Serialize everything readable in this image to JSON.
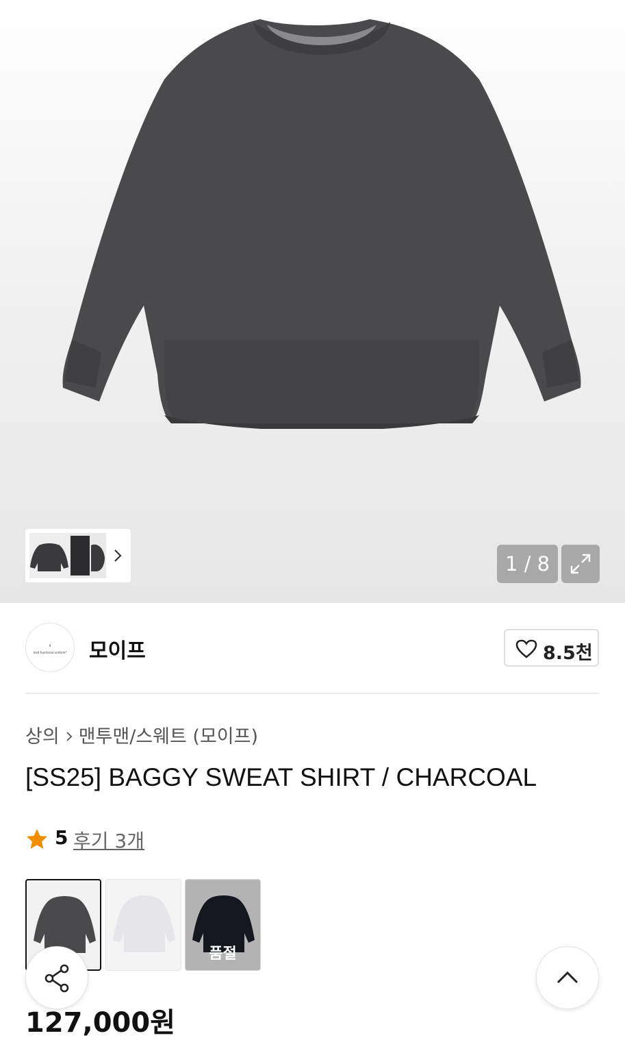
{
  "gallery": {
    "counter": "1 / 8",
    "thumbnail_next_icon": "chevron-right-icon",
    "expand_icon": "expand-icon",
    "colors": {
      "sweatshirt": "#4a4a4c",
      "overlay": "#a8a8a8"
    }
  },
  "brand": {
    "name": "모이프",
    "logo_text": "⌽",
    "logo_subtext": "moif functional uniform*",
    "like_count": "8.5천",
    "like_icon": "heart-icon"
  },
  "breadcrumb": {
    "category": "상의",
    "subcategory": "맨투맨/스웨트 (모이프)",
    "separator_icon": "chevron-right-icon"
  },
  "product": {
    "title": "[SS25] BAGGY SWEAT SHIRT / CHARCOAL",
    "rating": "5",
    "reviews_label": "후기 3개",
    "rating_color": "#f28c00",
    "price": "127,000원"
  },
  "colors_options": [
    {
      "name": "charcoal",
      "selected": true,
      "soldout_label": ""
    },
    {
      "name": "white",
      "selected": false,
      "soldout_label": ""
    },
    {
      "name": "navy",
      "selected": false,
      "soldout_label": "품절"
    }
  ],
  "floating": {
    "share_icon": "share-icon",
    "top_icon": "chevron-up-icon"
  }
}
